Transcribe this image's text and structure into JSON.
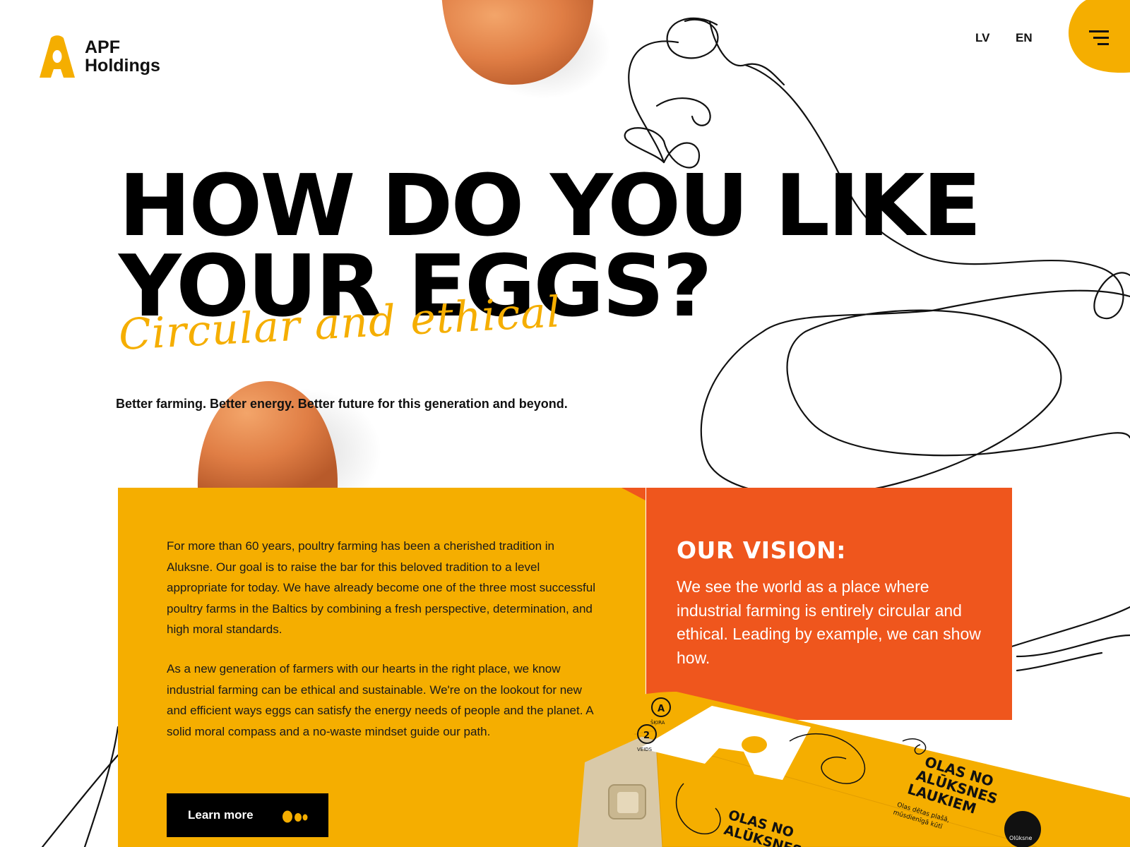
{
  "header": {
    "logo_line1": "APF",
    "logo_line2": "Holdings",
    "lang_lv": "LV",
    "lang_en": "EN"
  },
  "hero": {
    "title_line1": "HOW DO YOU LIKE",
    "title_line2": "YOUR EGGS?",
    "subtitle": "Circular and ethical",
    "tagline": "Better farming. Better energy. Better future for this generation and beyond."
  },
  "about": {
    "paragraph1": "For more than 60 years, poultry farming has been a cherished tradition in Aluksne. Our goal is to raise the bar for this beloved tradition to a level appropriate for today. We have already become one of the three most successful poultry farms in the Baltics by combining a fresh perspective, determination, and high moral standards.",
    "paragraph2": "As a new generation of farmers with our hearts in the right place, we know industrial farming can be ethical and sustainable. We're on the lookout for new and efficient ways eggs can satisfy the energy needs of people and the planet. A solid moral compass and a no-waste mindset guide our path.",
    "learn_more": "Learn more"
  },
  "vision": {
    "title": "OUR VISION:",
    "text": "We see the world as a place where industrial farming is entirely circular and ethical. Leading by example, we can show how."
  },
  "carton": {
    "brand_text1": "OLAS NO",
    "brand_text2": "ALŪKSNES",
    "brand_text3": "LAUKIEM",
    "small_text1": "Olas dētas plašā,",
    "small_text2": "mūsdienīgā kūtī",
    "front_text1": "OLAS NO",
    "front_text2": "ALŪKSNES",
    "seal_text": "Olūksne",
    "label_skira": "ŠĶIRA",
    "label_veids": "VEIDS",
    "grade": "A",
    "type": "2"
  },
  "colors": {
    "brand_yellow": "#f5ae00",
    "vision_orange": "#ef561d",
    "ink": "#000000"
  },
  "icons": [
    "logo-a-icon",
    "hamburger-menu-icon",
    "two-eggs-icon"
  ]
}
